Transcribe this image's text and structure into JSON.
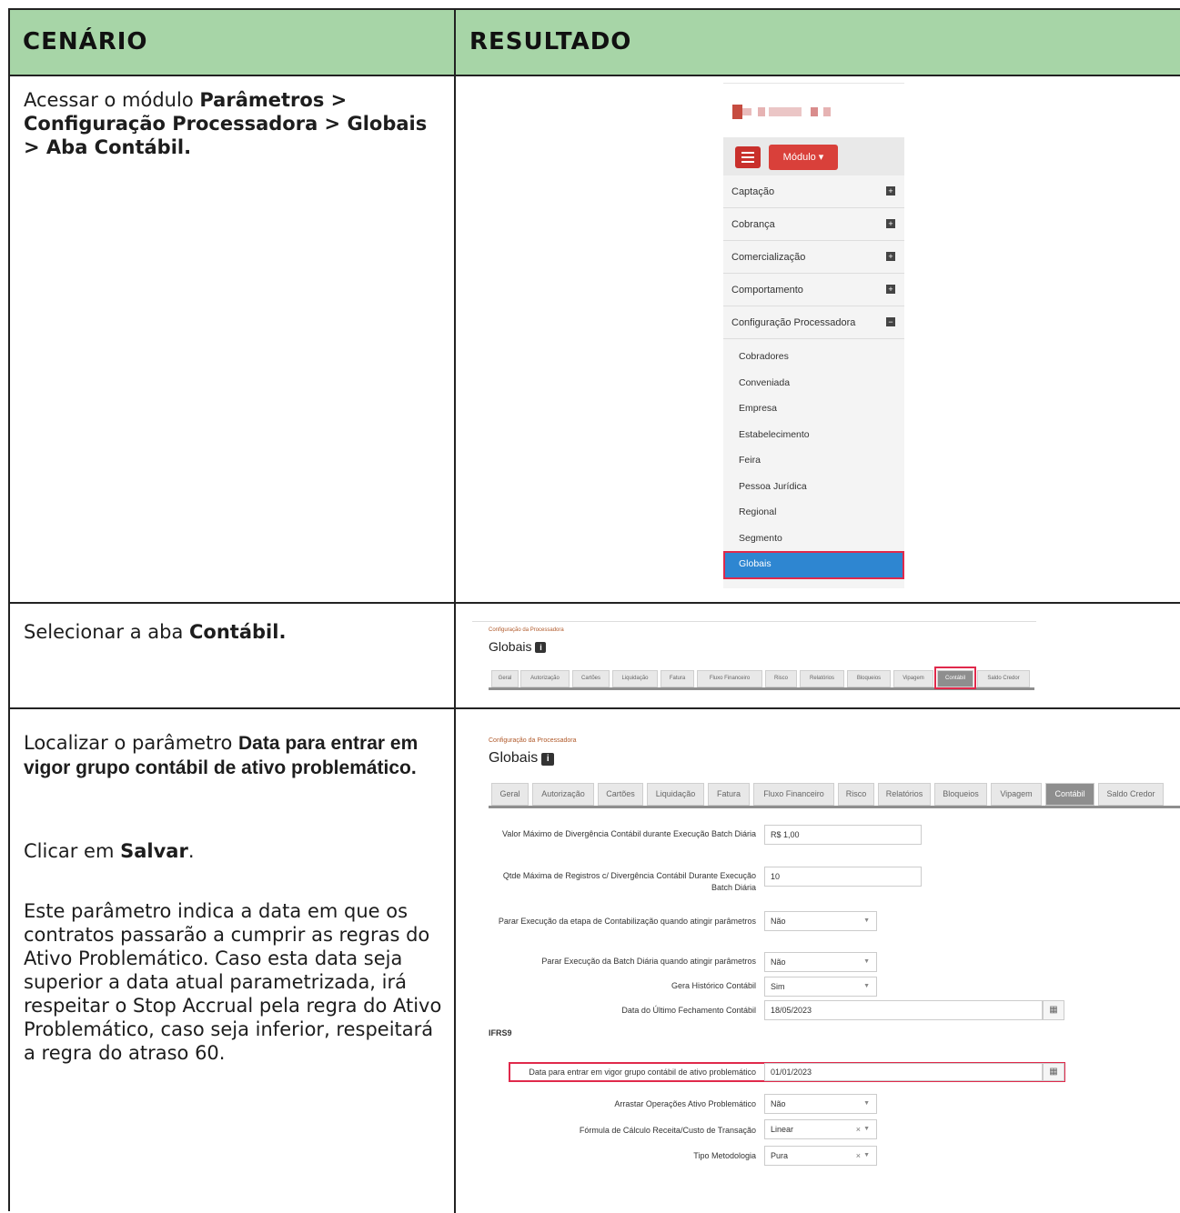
{
  "header": {
    "col1": "CENÁRIO",
    "col2": "RESULTADO"
  },
  "rows": [
    {
      "left": {
        "t1": "Acessar o módulo ",
        "b1": "Parâmetros > Configuração Processadora > Globais > Aba Contábil."
      }
    },
    {
      "left": {
        "t1": "Selecionar a aba ",
        "b1": "Contábil."
      }
    },
    {
      "left": {
        "t1": "Localizar o parâmetro ",
        "b1": "Data para entrar em vigor grupo contábil de ativo problemático.",
        "t2": "Clicar em ",
        "b2": "Salvar",
        "t2end": ".",
        "p3": "Este parâmetro indica a data em que os contratos passarão a cumprir as regras do Ativo Problemático. Caso esta data seja superior a data atual parametrizada, irá respeitar o Stop Accrual pela regra do Ativo Problemático, caso seja inferior, respeitará a regra do atraso 60."
      }
    }
  ],
  "menu": {
    "module_button": "Módulo",
    "items": [
      "Captação",
      "Cobrança",
      "Comercialização",
      "Comportamento",
      "Configuração Processadora"
    ],
    "subitems": [
      "Cobradores",
      "Conveniada",
      "Empresa",
      "Estabelecimento",
      "Feira",
      "Pessoa Jurídica",
      "Regional",
      "Segmento",
      "Globais"
    ],
    "active_subitem": "Globais"
  },
  "screen": {
    "breadcrumb": "Configuração da Processadora",
    "title": "Globais",
    "info_badge": "i",
    "tabs": [
      "Geral",
      "Autorização",
      "Cartões",
      "Liquidação",
      "Fatura",
      "Fluxo Financeiro",
      "Risco",
      "Relatórios",
      "Bloqueios",
      "Vipagem",
      "Contábil",
      "Saldo Credor"
    ],
    "selected_tab": "Contábil"
  },
  "form": {
    "fields": [
      {
        "label": "Valor Máximo de Divergência Contábil durante Execução Batch Diária",
        "value": "R$ 1,00"
      },
      {
        "label": "Qtde Máxima de Registros c/ Divergência Contábil Durante Execução Batch Diária",
        "value": "10"
      },
      {
        "label": "Parar Execução da etapa de Contabilização quando atingir parâmetros",
        "value": "Não"
      },
      {
        "label": "Parar Execução da Batch Diária quando atingir parâmetros",
        "value": "Não"
      },
      {
        "label": "Gera Histórico Contábil",
        "value": "Sim"
      },
      {
        "label": "Data do Último Fechamento Contábil",
        "value": "18/05/2023"
      }
    ],
    "section": "IFRS9",
    "ifrs": [
      {
        "label": "Data para entrar em vigor grupo contábil de ativo problemático",
        "value": "01/01/2023"
      },
      {
        "label": "Arrastar Operações Ativo Problemático",
        "value": "Não"
      },
      {
        "label": "Fórmula de Cálculo Receita/Custo de Transação",
        "value": "Linear"
      },
      {
        "label": "Tipo Metodologia",
        "value": "Pura"
      }
    ]
  },
  "colors": {
    "header_bg": "#a7d5a7",
    "highlight": "#e0294b",
    "active_blue": "#2e86d1",
    "brand_red": "#c9302c"
  }
}
